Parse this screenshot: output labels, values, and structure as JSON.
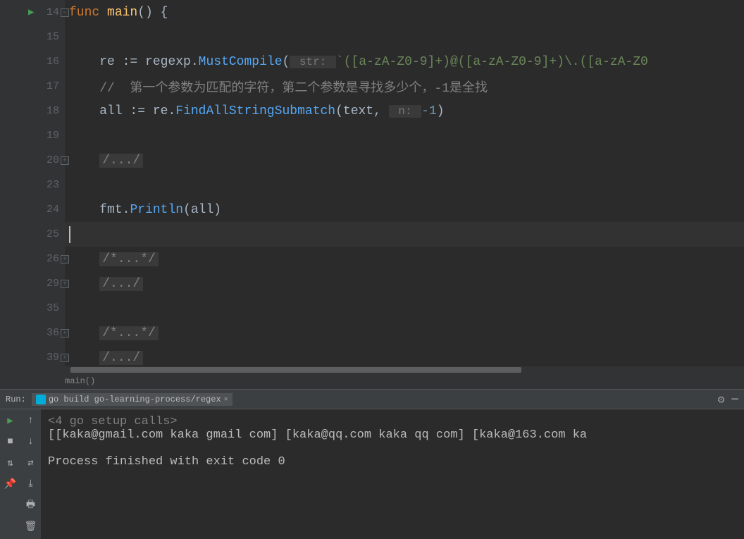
{
  "lines": [
    {
      "num": "14",
      "run": true,
      "fold": "minus"
    },
    {
      "num": "15"
    },
    {
      "num": "16"
    },
    {
      "num": "17"
    },
    {
      "num": "18"
    },
    {
      "num": "19"
    },
    {
      "num": "20",
      "fold": "plus"
    },
    {
      "num": "23"
    },
    {
      "num": "24"
    },
    {
      "num": "25"
    },
    {
      "num": "26",
      "fold": "plus"
    },
    {
      "num": "29",
      "fold": "plus"
    },
    {
      "num": "35"
    },
    {
      "num": "36",
      "fold": "plus"
    },
    {
      "num": "39",
      "fold": "plus"
    }
  ],
  "code": {
    "l14": {
      "func_kw": "func ",
      "main": "main",
      "rest": "() {"
    },
    "l16": {
      "indent": "    ",
      "re": "re",
      "assign": " := ",
      "regexp": "regexp",
      "dot": ".",
      "method": "MustCompile",
      "open": "(",
      "hint": " str: ",
      "str": "`([a-zA-Z0-9]+)@([a-zA-Z0-9]+)\\.([a-zA-Z0"
    },
    "l17": {
      "indent": "    ",
      "comment": "//  第一个参数为匹配的字符，第二个参数是寻找多少个，-1是全找"
    },
    "l18": {
      "indent": "    ",
      "all": "all",
      "assign": " := ",
      "re": "re",
      "dot": ".",
      "method": "FindAllStringSubmatch",
      "open": "(",
      "text": "text",
      "comma": ", ",
      "hint": " n: ",
      "num": "-1",
      "close": ")"
    },
    "l20": {
      "folded": "/.../"
    },
    "l24": {
      "indent": "    ",
      "fmt": "fmt",
      "dot": ".",
      "method": "Println",
      "open": "(",
      "all": "all",
      "close": ")"
    },
    "l26": {
      "folded": "/*...*/"
    },
    "l29": {
      "folded": "/.../"
    },
    "l36": {
      "folded": "/*...*/"
    },
    "l39": {
      "folded": "/.../"
    }
  },
  "breadcrumb": "main()",
  "run": {
    "label": "Run:",
    "tab": "go build go-learning-process/regex",
    "setup": "<4 go setup calls>",
    "output": "[[kaka@gmail.com kaka gmail com] [kaka@qq.com kaka qq com] [kaka@163.com ka",
    "exit": "Process finished with exit code 0"
  }
}
